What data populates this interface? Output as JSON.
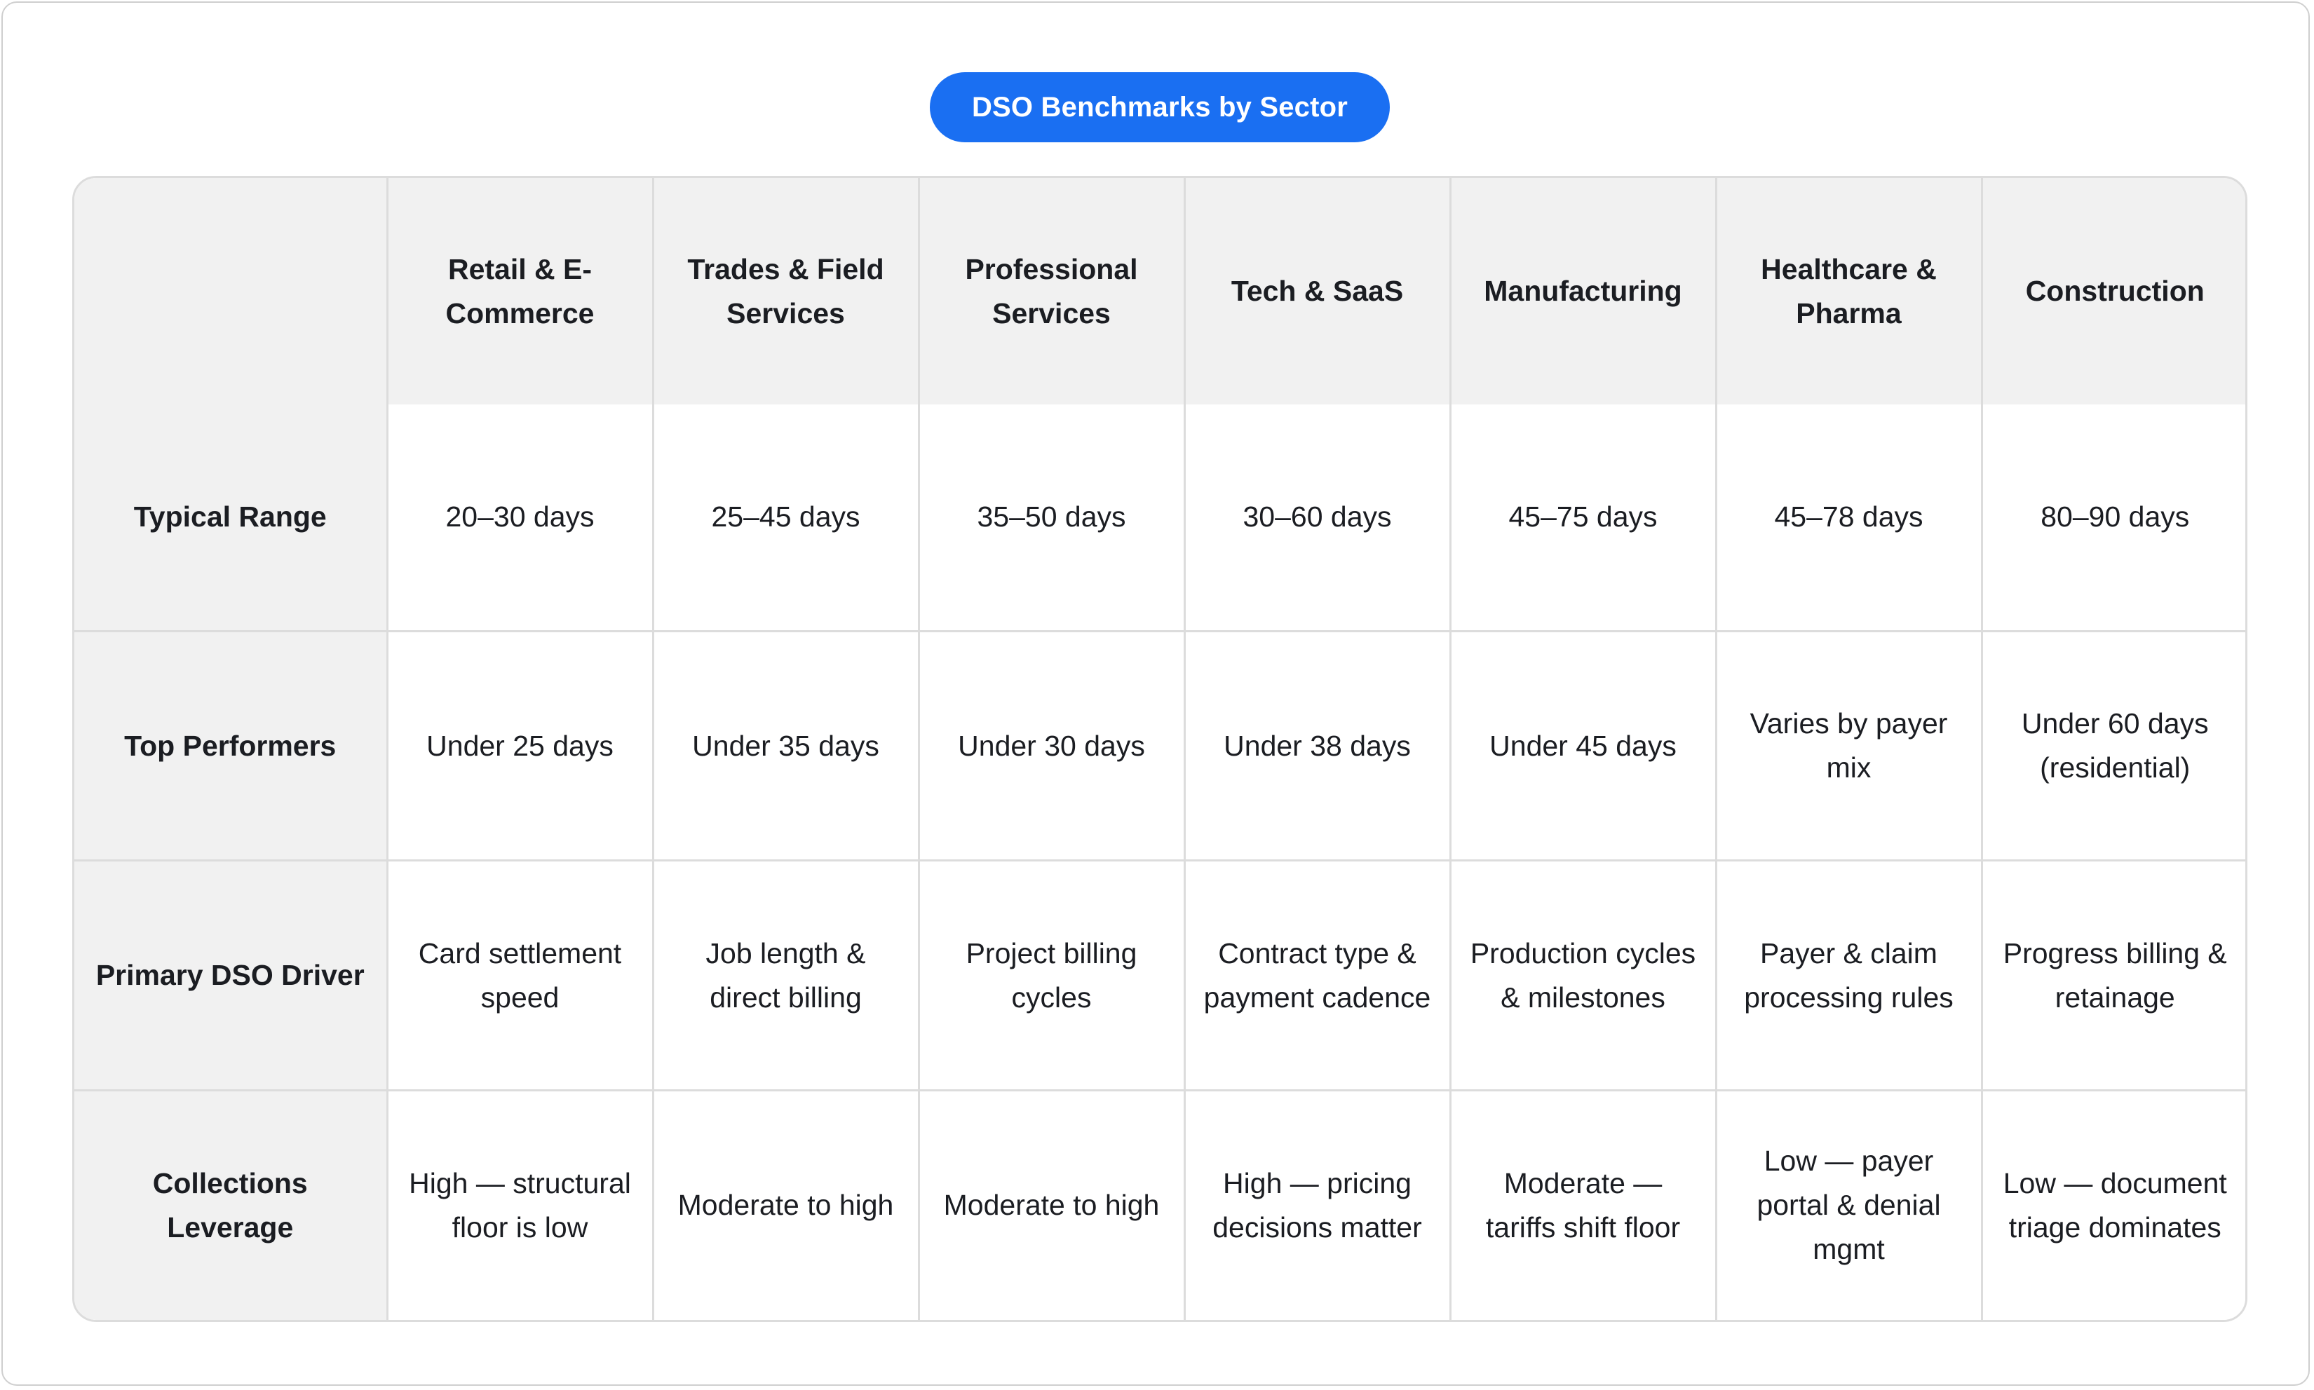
{
  "title": "DSO Benchmarks by Sector",
  "table": {
    "corner": "",
    "columns": [
      "Retail & E-Commerce",
      "Trades & Field Services",
      "Professional Services",
      "Tech & SaaS",
      "Manufacturing",
      "Healthcare & Pharma",
      "Construction"
    ],
    "rows": [
      {
        "label": "Typical Range",
        "cells": [
          "20–30 days",
          "25–45 days",
          "35–50 days",
          "30–60 days",
          "45–75 days",
          "45–78 days",
          "80–90 days"
        ]
      },
      {
        "label": "Top Performers",
        "cells": [
          "Under 25 days",
          "Under 35 days",
          "Under 30 days",
          "Under 38 days",
          "Under 45 days",
          "Varies by payer mix",
          "Under 60 days (residential)"
        ]
      },
      {
        "label": "Primary DSO Driver",
        "cells": [
          "Card settlement speed",
          "Job length & direct billing",
          "Project billing cycles",
          "Contract type & payment cadence",
          "Production cycles & milestones",
          "Payer & claim processing rules",
          "Progress billing & retainage"
        ]
      },
      {
        "label": "Collections Leverage",
        "cells": [
          "High — structural floor is low",
          "Moderate to high",
          "Moderate to high",
          "High — pricing decisions matter",
          "Moderate — tariffs shift floor",
          "Low — payer portal & denial mgmt",
          "Low — document triage dominates"
        ]
      }
    ]
  },
  "colors": {
    "accent": "#1a6ff2",
    "header_bg": "#f1f1f1",
    "border": "#dcdcdc",
    "text": "#1b1d22"
  }
}
